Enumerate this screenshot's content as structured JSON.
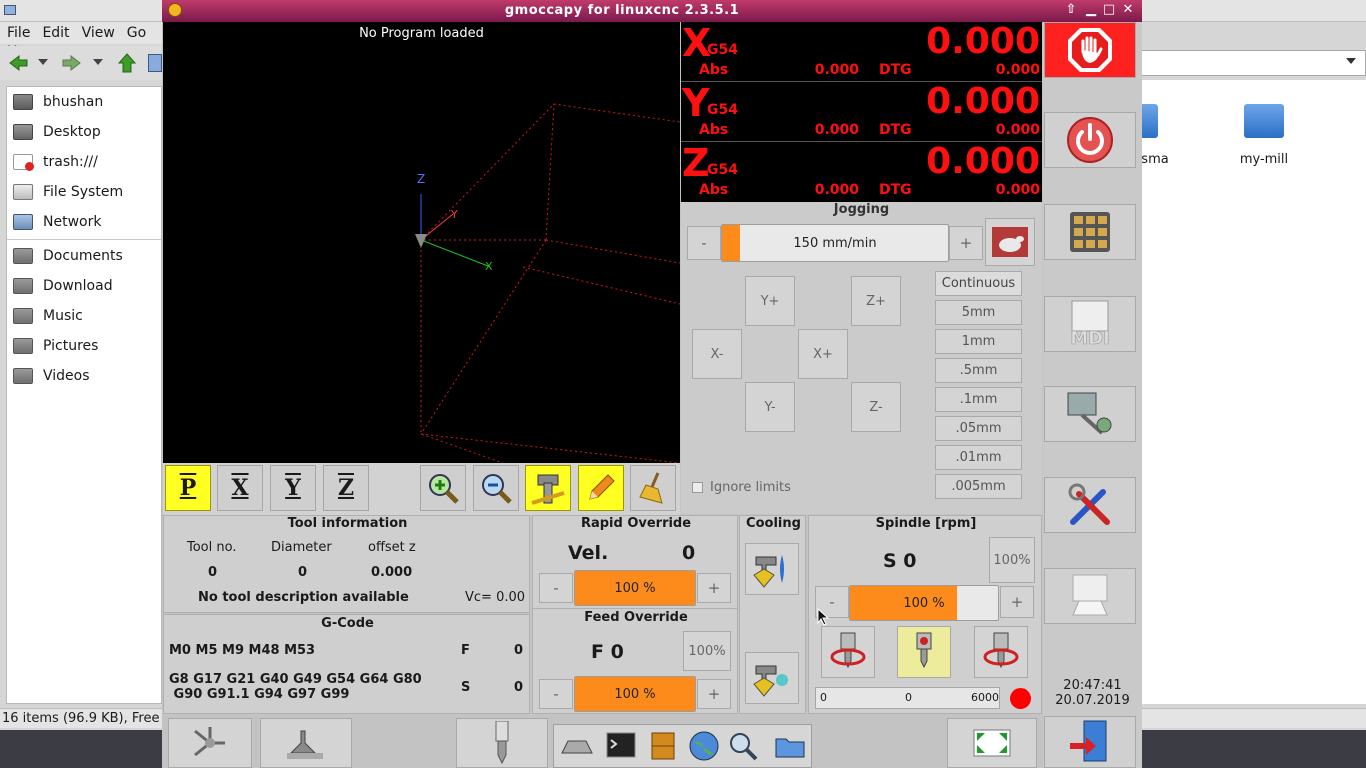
{
  "file_manager": {
    "menu": [
      "File",
      "Edit",
      "View",
      "Go",
      "H"
    ],
    "sidebar_items": [
      {
        "label": "bhushan",
        "icon": "home-folder-icon"
      },
      {
        "label": "Desktop",
        "icon": "desktop-icon"
      },
      {
        "label": "trash:///",
        "icon": "trash-icon"
      },
      {
        "label": "File System",
        "icon": "drive-icon"
      },
      {
        "label": "Network",
        "icon": "network-icon"
      },
      {
        "label": "Documents",
        "icon": "folder-icon"
      },
      {
        "label": "Download",
        "icon": "folder-icon"
      },
      {
        "label": "Music",
        "icon": "folder-icon"
      },
      {
        "label": "Pictures",
        "icon": "folder-icon"
      },
      {
        "label": "Videos",
        "icon": "folder-icon"
      }
    ],
    "files": [
      {
        "label": "sma"
      },
      {
        "label": "my-mill"
      }
    ],
    "status": "16 items (96.9 KB), Free"
  },
  "window": {
    "title": "gmoccapy for linuxcnc  2.3.5.1"
  },
  "preview": {
    "label": "No Program loaded",
    "axis_labels": {
      "z": "Z",
      "x": "X",
      "y": "Y"
    },
    "view_buttons": [
      "P",
      "X",
      "Y",
      "Z"
    ]
  },
  "dro": [
    {
      "axis": "X",
      "coord": "G54",
      "value": "0.000",
      "abs_label": "Abs",
      "abs": "0.000",
      "dtg_label": "DTG",
      "dtg": "0.000"
    },
    {
      "axis": "Y",
      "coord": "G54",
      "value": "0.000",
      "abs_label": "Abs",
      "abs": "0.000",
      "dtg_label": "DTG",
      "dtg": "0.000"
    },
    {
      "axis": "Z",
      "coord": "G54",
      "value": "0.000",
      "abs_label": "Abs",
      "abs": "0.000",
      "dtg_label": "DTG",
      "dtg": "0.000"
    }
  ],
  "jogging": {
    "title": "Jogging",
    "speed_minus": "-",
    "speed_plus": "+",
    "speed": "150 mm/min",
    "speed_fraction": 0.08,
    "buttons": {
      "y_plus": "Y+",
      "z_plus": "Z+",
      "x_minus": "X-",
      "x_plus": "X+",
      "y_minus": "Y-",
      "z_minus": "Z-"
    },
    "increments": [
      "Continuous",
      "5mm",
      "1mm",
      ".5mm",
      ".1mm",
      ".05mm",
      ".01mm",
      ".005mm"
    ],
    "ignore_limits": "Ignore limits"
  },
  "tool_info": {
    "title": "Tool information",
    "headers": [
      "Tool no.",
      "Diameter",
      "offset z"
    ],
    "values": [
      "0",
      "0",
      "0.000"
    ],
    "description": "No tool description available",
    "vc": "Vc= 0.00"
  },
  "rapid_override": {
    "title": "Rapid Override",
    "vel_label": "Vel.",
    "vel_value": "0",
    "minus": "-",
    "plus": "+",
    "percent": "100 %",
    "fraction": 1.0
  },
  "feed_override": {
    "title": "Feed Override",
    "f_label": "F  0",
    "reset": "100%",
    "minus": "-",
    "plus": "+",
    "percent": "100 %",
    "fraction": 1.0
  },
  "cooling": {
    "title": "Cooling"
  },
  "spindle": {
    "title": "Spindle [rpm]",
    "s_label": "S 0",
    "reset": "100%",
    "minus": "-",
    "plus": "+",
    "percent": "100 %",
    "fraction": 0.72,
    "bar_min": "0",
    "bar_value": "0",
    "bar_max": "6000",
    "status_color": "#ff0000"
  },
  "gcode": {
    "title": "G-Code",
    "m_codes": "M0 M5 M9 M48 M53",
    "g_codes_line1": "G8 G17 G21 G40 G49 G54 G64 G80",
    "g_codes_line2": " G90 G91.1 G94 G97 G99",
    "f_label": "F",
    "f_value": "0",
    "s_label": "S",
    "s_value": "0"
  },
  "clock": {
    "time": "20:47:41",
    "date": "20.07.2019"
  },
  "colors": {
    "accent_orange": "#fd8b1c",
    "dro_red": "#ff1010",
    "estop_red": "#ff2020",
    "highlight_yellow": "#ffff22",
    "titlebar": "#a02858"
  }
}
